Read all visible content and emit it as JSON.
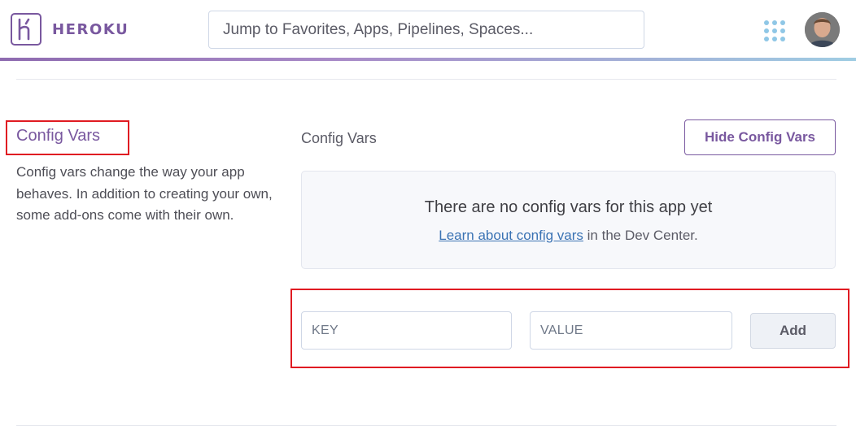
{
  "header": {
    "brand": "HEROKU",
    "search_placeholder": "Jump to Favorites, Apps, Pipelines, Spaces..."
  },
  "config_vars": {
    "title": "Config Vars",
    "description": "Config vars change the way your app behaves. In addition to creating your own, some add-ons come with their own.",
    "panel_label": "Config Vars",
    "hide_button": "Hide Config Vars",
    "empty_title": "There are no config vars for this app yet",
    "empty_link": "Learn about config vars",
    "empty_suffix": " in the Dev Center.",
    "key_placeholder": "KEY",
    "value_placeholder": "VALUE",
    "add_button": "Add"
  },
  "colors": {
    "brand_purple": "#79589f",
    "highlight_red": "#e01b22",
    "link_blue": "#3b73b4"
  },
  "icons": [
    "heroku-logo-icon",
    "apps-grid-icon",
    "user-avatar"
  ]
}
